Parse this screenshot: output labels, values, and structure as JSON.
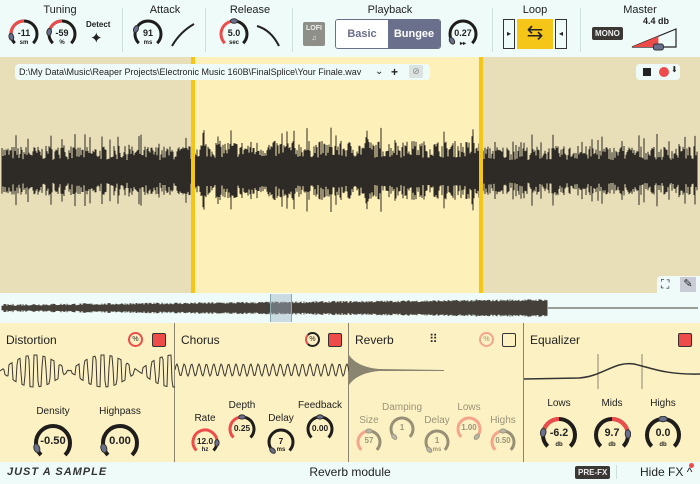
{
  "colors": {
    "accent_red": "#ee4b4b",
    "yellow": "#f5c518",
    "wave": "#2e2a26",
    "panel": "#fcf1c2",
    "toolbar": "#eefbf8",
    "selected_region": "#fdf0b8",
    "unselected_region": "#e8dfb8",
    "button_active": "#6a6f8c"
  },
  "toolbar": {
    "tuning": {
      "title": "Tuning",
      "semitones": {
        "value": "-11",
        "unit": "sm",
        "level": 0.12,
        "bipolar": true
      },
      "cents": {
        "value": "-59",
        "unit": "%",
        "level": 0.2,
        "bipolar": true
      },
      "detect_label": "Detect",
      "detect_icon": "magic-wand-icon"
    },
    "attack": {
      "title": "Attack",
      "knob": {
        "value": "91",
        "unit": "ms",
        "level": 0.25,
        "bipolar": false
      },
      "curve_icon": "attack-curve-icon"
    },
    "release": {
      "title": "Release",
      "knob": {
        "value": "5.0",
        "unit": "sec",
        "level": 0.5,
        "bipolar": false,
        "full_red": true
      },
      "curve_icon": "release-curve-icon"
    },
    "lofi_label": "LOFI",
    "playback": {
      "title": "Playback",
      "options": [
        "Basic",
        "Bungee"
      ],
      "selected": "Bungee",
      "speed": {
        "value": "0.27",
        "unit": "▸▸",
        "level": 0.05,
        "bipolar": false
      }
    },
    "loop": {
      "title": "Loop",
      "enabled": true
    },
    "master": {
      "title": "Master",
      "mono_label": "MONO",
      "gain_label": "4.4 db",
      "gain_level": 0.6
    }
  },
  "file": {
    "path": "D:\\My Data\\Music\\Reaper Projects\\Electronic Music 160B\\FinalSplice\\Your Finale.wav"
  },
  "selection": {
    "start": 0.275,
    "end": 0.687
  },
  "overview_window": {
    "start": 0.386,
    "end": 0.417
  },
  "fx": {
    "distortion": {
      "title": "Distortion",
      "enabled": true,
      "knobs": [
        {
          "label": "Density",
          "value": "-0.50",
          "level": 0.1,
          "bipolar": false
        },
        {
          "label": "Highpass",
          "value": "0.00",
          "level": 0.1,
          "bipolar": false
        }
      ]
    },
    "chorus": {
      "title": "Chorus",
      "enabled": true,
      "knobs": [
        {
          "label": "Rate",
          "value": "12.0",
          "unit": "hz",
          "level": 0.85,
          "bipolar": false,
          "full_red": true
        },
        {
          "label": "Depth",
          "value": "0.25",
          "level": 0.5,
          "bipolar": false,
          "full_red": true
        },
        {
          "label": "Delay",
          "value": "7",
          "unit": "ms",
          "level": 0.0,
          "bipolar": false
        },
        {
          "label": "Feedback",
          "value": "0.00",
          "level": 0.5,
          "bipolar": false
        }
      ]
    },
    "reverb": {
      "title": "Reverb",
      "enabled": false,
      "knobs": [
        {
          "label": "Size",
          "value": "57",
          "level": 0.5,
          "bipolar": false,
          "full_red": true
        },
        {
          "label": "Damping",
          "value": "1",
          "level": 0.0,
          "bipolar": false
        },
        {
          "label": "Delay",
          "value": "1",
          "unit": "ms",
          "level": 0.0,
          "bipolar": false
        },
        {
          "label": "Lows",
          "value": "1.00",
          "level": 1.0,
          "bipolar": false,
          "full_red": true
        },
        {
          "label": "Highs",
          "value": "0.50",
          "level": 0.5,
          "bipolar": false,
          "full_red": true
        }
      ]
    },
    "equalizer": {
      "title": "Equalizer",
      "enabled": true,
      "knobs": [
        {
          "label": "Lows",
          "value": "-6.2",
          "unit": "db",
          "level": 0.2,
          "bipolar": true
        },
        {
          "label": "Mids",
          "value": "9.7",
          "unit": "db",
          "level": 0.82,
          "bipolar": true
        },
        {
          "label": "Highs",
          "value": "0.0",
          "unit": "db",
          "level": 0.5,
          "bipolar": true
        }
      ]
    }
  },
  "footer": {
    "logo_text": "JUST A SAMPLE",
    "status": "Reverb module",
    "prefx_label": "PRE-FX",
    "hide_fx_label": "Hide FX"
  }
}
